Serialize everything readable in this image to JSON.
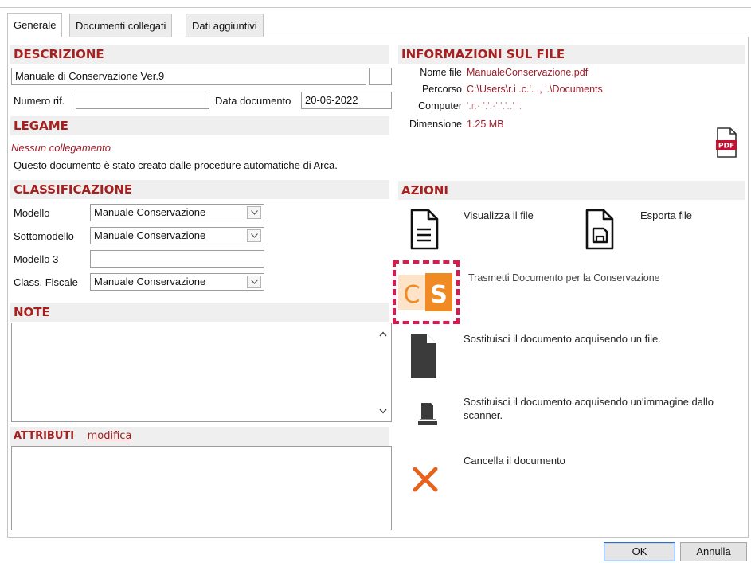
{
  "tabs": [
    "Generale",
    "Documenti collegati",
    "Dati aggiuntivi"
  ],
  "descrizione": {
    "heading": "DESCRIZIONE",
    "description_value": "Manuale di Conservazione Ver.9",
    "numero_rif_label": "Numero rif.",
    "numero_rif_value": "",
    "data_documento_label": "Data documento",
    "data_documento_value": "20-06-2022"
  },
  "legame": {
    "heading": "LEGAME",
    "link_status": "Nessun collegamento",
    "note": "Questo documento è stato creato dalle procedure automatiche di Arca."
  },
  "classificazione": {
    "heading": "CLASSIFICAZIONE",
    "modello_label": "Modello",
    "modello_value": "Manuale Conservazione",
    "sottomodello_label": "Sottomodello",
    "sottomodello_value": "Manuale Conservazione",
    "modello3_label": "Modello 3",
    "modello3_value": "",
    "class_fiscale_label": "Class. Fiscale",
    "class_fiscale_value": "Manuale Conservazione"
  },
  "note": {
    "heading": "NOTE"
  },
  "attributi": {
    "heading": "ATTRIBUTI",
    "edit_link": "modifica"
  },
  "file_info": {
    "heading": "INFORMAZIONI SUL FILE",
    "nome_file_label": "Nome file",
    "nome_file_value": "ManualeConservazione.pdf",
    "percorso_label": "Percorso",
    "percorso_value": "C:\\Users\\r.i .c.'. ., '.\\Documents",
    "computer_label": "Computer",
    "computer_value": "'.r.· '.'.·'.'.'..' '.",
    "dimensione_label": "Dimensione",
    "dimensione_value": "1.25 MB",
    "pdf_badge": "PDF"
  },
  "azioni": {
    "heading": "AZIONI",
    "view_file": "Visualizza il file",
    "export_file": "Esporta file",
    "transmit": "Trasmetti Documento per la Conservazione",
    "replace_file": "Sostituisci il documento acquisendo un file.",
    "replace_scanner": "Sostituisci il documento acquisendo un'immagine dallo scanner.",
    "delete": "Cancella il documento",
    "cs_logo_text": "CS"
  },
  "buttons": {
    "ok": "OK",
    "cancel": "Annulla"
  },
  "colors": {
    "accent": "#a5201f",
    "value_red": "#a01c2a",
    "highlight_dash": "#e0174f",
    "cs_orange": "#f08a24",
    "delete_x": "#e8621d"
  },
  "icons": [
    "document-icon",
    "export-document-icon",
    "pdf-icon",
    "cs-logo-icon",
    "file-icon",
    "scanner-icon",
    "delete-icon",
    "chevron-down-icon",
    "scroll-up-icon",
    "scroll-down-icon"
  ]
}
